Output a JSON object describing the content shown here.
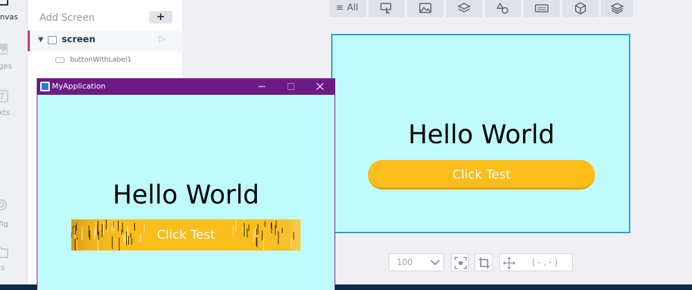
{
  "nav_rail": {
    "items": [
      {
        "label": "nvas"
      },
      {
        "label": "ages"
      },
      {
        "label": "exts"
      },
      {
        "label": "nfig"
      },
      {
        "label": "les"
      }
    ]
  },
  "screens_panel": {
    "add_screen_label": "Add Screen",
    "add_button_label": "+",
    "screens": [
      {
        "name": "screen",
        "widgets": [
          "buttonWithLabel1"
        ]
      }
    ]
  },
  "toolbar": {
    "filter_all_label": "All",
    "tools": [
      "interaction-icon",
      "image-icon",
      "layers-icon",
      "shapes-icon",
      "keyboard-icon",
      "box-3d-icon",
      "stack-icon"
    ]
  },
  "canvas": {
    "background": "#c0fbfb",
    "border_color": "#1aa3e0",
    "title_text": "Hello World",
    "button_label": "Click Test",
    "button_color": "#fbbd1c"
  },
  "canvas_controls": {
    "zoom_value": "100",
    "coordinates": "( - , - )"
  },
  "simulator": {
    "window_title": "MyApplication",
    "titlebar_color": "#6d1a85",
    "hello_text": "Hello World",
    "button_label": "Click Test"
  }
}
